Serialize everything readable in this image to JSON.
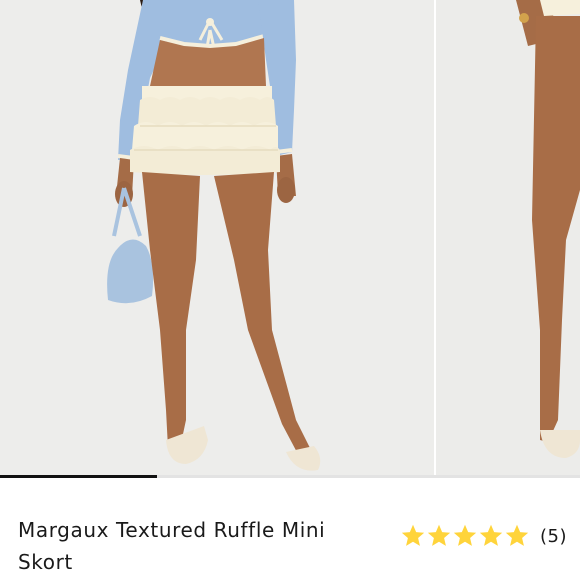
{
  "product": {
    "name": "Margaux Textured Ruffle Mini Skort",
    "rating": 5,
    "rating_max": 5,
    "review_count_label": "(5)"
  },
  "gallery": {
    "image_count": 3,
    "current_image": 1,
    "progress": 0.27
  },
  "colors": {
    "star": "#FFD43B",
    "text": "#1A1A1A",
    "progress": "#111111",
    "photo_background": "#EDEDEB",
    "top_color": "#9FBDE0",
    "skort_color": "#F6F0DC",
    "bag_color": "#A9C3DF",
    "shoe_color": "#EFE6D4"
  },
  "icons": {
    "star": "star-icon"
  }
}
